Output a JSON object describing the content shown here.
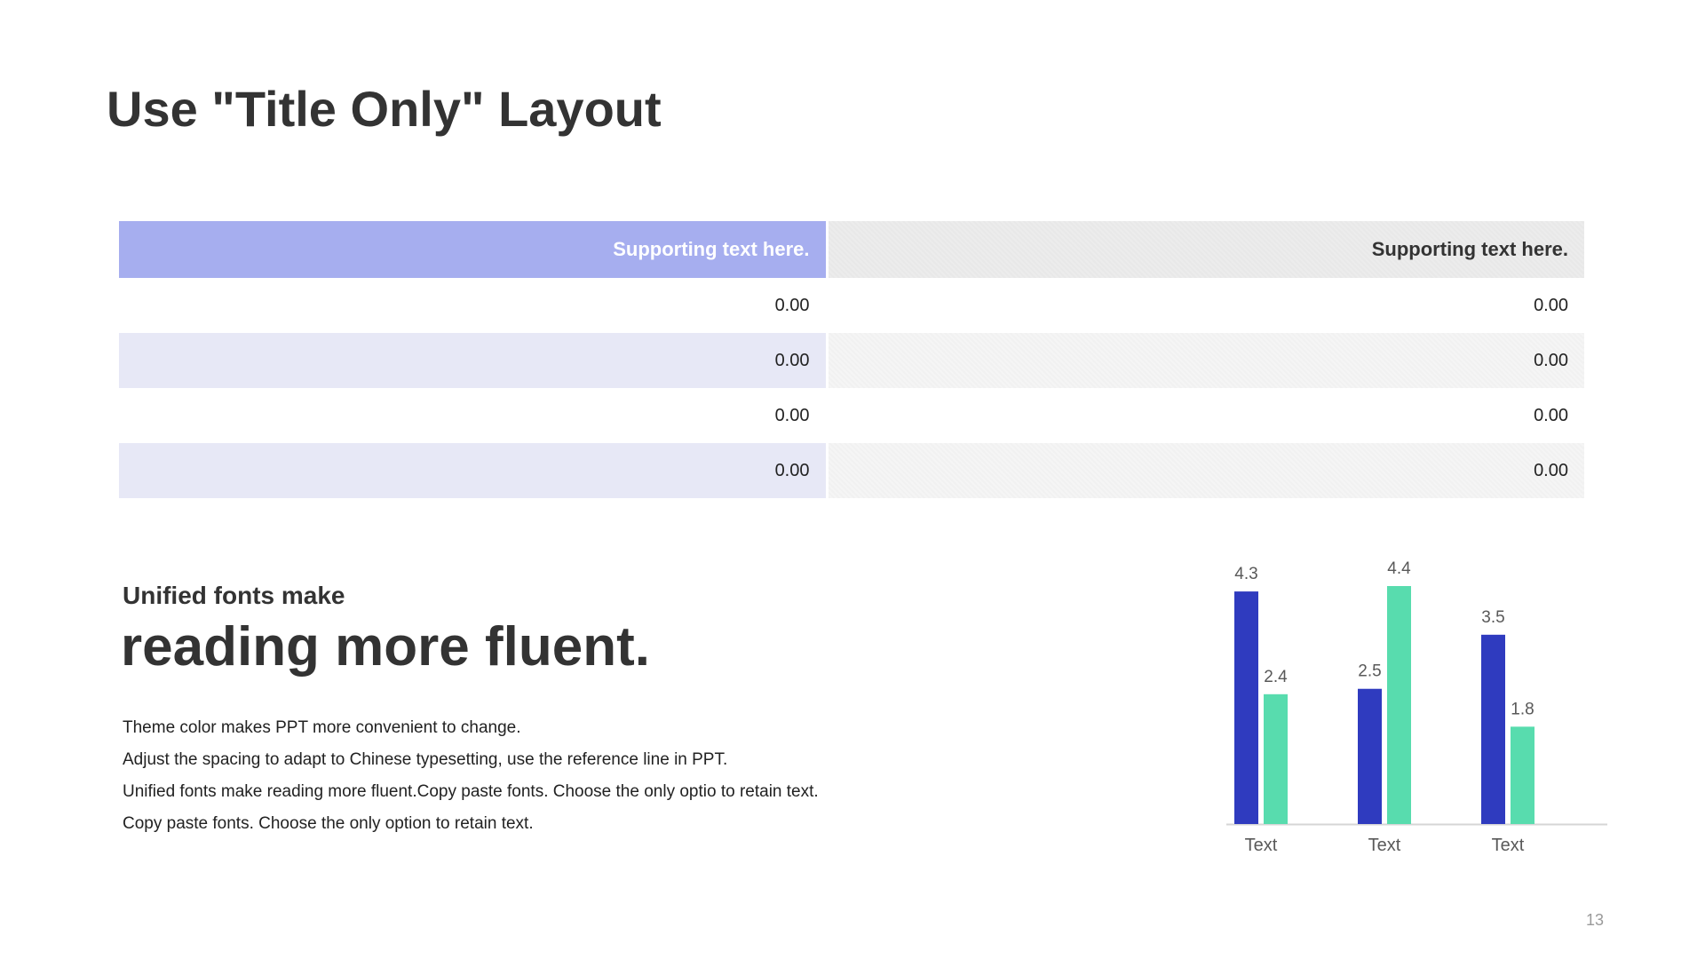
{
  "slide": {
    "title": "Use \"Title Only\" Layout",
    "page_number": "13"
  },
  "table": {
    "headers": [
      "Supporting text here.",
      "Supporting text here."
    ],
    "rows": [
      [
        "0.00",
        "0.00"
      ],
      [
        "0.00",
        "0.00"
      ],
      [
        "0.00",
        "0.00"
      ],
      [
        "0.00",
        "0.00"
      ]
    ],
    "colors": {
      "header_accent": "#a6aeef",
      "row_tint": "#e7e8f6"
    }
  },
  "text_block": {
    "sub_heading": "Unified fonts make",
    "big_heading": "reading more fluent.",
    "lines": [
      "Theme  color makes  PPT more convenient  to change.",
      "Adjust  the spacing  to adapt to Chinese  typesetting, use  the reference line  in  PPT.",
      "Unified  fonts make reading more fluent.Copy paste fonts. Choose the only optio to retain text.",
      "Copy paste  fonts. Choose the only option to retain text."
    ]
  },
  "chart_data": {
    "type": "bar",
    "categories": [
      "Text",
      "Text",
      "Text"
    ],
    "series": [
      {
        "values": [
          4.3,
          2.5,
          3.5
        ],
        "color": "#2f3bbf"
      },
      {
        "values": [
          2.4,
          4.4,
          1.8
        ],
        "color": "#58dcae"
      }
    ],
    "ylim": [
      0,
      4.4
    ],
    "grid": false,
    "legend": "none"
  }
}
